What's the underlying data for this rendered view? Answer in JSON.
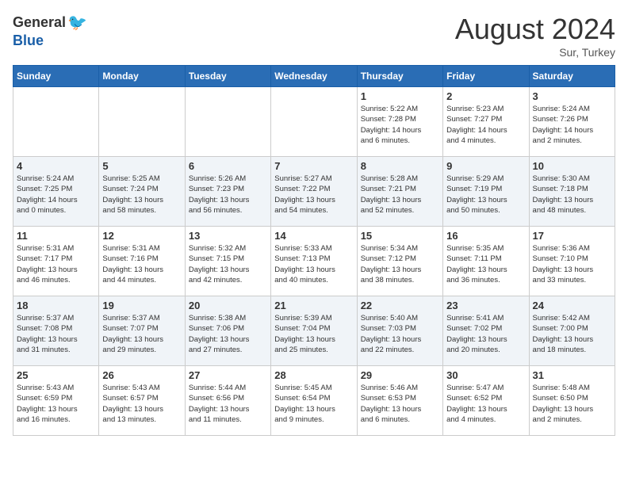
{
  "header": {
    "logo_general": "General",
    "logo_blue": "Blue",
    "month_title": "August 2024",
    "location": "Sur, Turkey"
  },
  "days_of_week": [
    "Sunday",
    "Monday",
    "Tuesday",
    "Wednesday",
    "Thursday",
    "Friday",
    "Saturday"
  ],
  "weeks": [
    [
      {
        "day": "",
        "info": ""
      },
      {
        "day": "",
        "info": ""
      },
      {
        "day": "",
        "info": ""
      },
      {
        "day": "",
        "info": ""
      },
      {
        "day": "1",
        "info": "Sunrise: 5:22 AM\nSunset: 7:28 PM\nDaylight: 14 hours\nand 6 minutes."
      },
      {
        "day": "2",
        "info": "Sunrise: 5:23 AM\nSunset: 7:27 PM\nDaylight: 14 hours\nand 4 minutes."
      },
      {
        "day": "3",
        "info": "Sunrise: 5:24 AM\nSunset: 7:26 PM\nDaylight: 14 hours\nand 2 minutes."
      }
    ],
    [
      {
        "day": "4",
        "info": "Sunrise: 5:24 AM\nSunset: 7:25 PM\nDaylight: 14 hours\nand 0 minutes."
      },
      {
        "day": "5",
        "info": "Sunrise: 5:25 AM\nSunset: 7:24 PM\nDaylight: 13 hours\nand 58 minutes."
      },
      {
        "day": "6",
        "info": "Sunrise: 5:26 AM\nSunset: 7:23 PM\nDaylight: 13 hours\nand 56 minutes."
      },
      {
        "day": "7",
        "info": "Sunrise: 5:27 AM\nSunset: 7:22 PM\nDaylight: 13 hours\nand 54 minutes."
      },
      {
        "day": "8",
        "info": "Sunrise: 5:28 AM\nSunset: 7:21 PM\nDaylight: 13 hours\nand 52 minutes."
      },
      {
        "day": "9",
        "info": "Sunrise: 5:29 AM\nSunset: 7:19 PM\nDaylight: 13 hours\nand 50 minutes."
      },
      {
        "day": "10",
        "info": "Sunrise: 5:30 AM\nSunset: 7:18 PM\nDaylight: 13 hours\nand 48 minutes."
      }
    ],
    [
      {
        "day": "11",
        "info": "Sunrise: 5:31 AM\nSunset: 7:17 PM\nDaylight: 13 hours\nand 46 minutes."
      },
      {
        "day": "12",
        "info": "Sunrise: 5:31 AM\nSunset: 7:16 PM\nDaylight: 13 hours\nand 44 minutes."
      },
      {
        "day": "13",
        "info": "Sunrise: 5:32 AM\nSunset: 7:15 PM\nDaylight: 13 hours\nand 42 minutes."
      },
      {
        "day": "14",
        "info": "Sunrise: 5:33 AM\nSunset: 7:13 PM\nDaylight: 13 hours\nand 40 minutes."
      },
      {
        "day": "15",
        "info": "Sunrise: 5:34 AM\nSunset: 7:12 PM\nDaylight: 13 hours\nand 38 minutes."
      },
      {
        "day": "16",
        "info": "Sunrise: 5:35 AM\nSunset: 7:11 PM\nDaylight: 13 hours\nand 36 minutes."
      },
      {
        "day": "17",
        "info": "Sunrise: 5:36 AM\nSunset: 7:10 PM\nDaylight: 13 hours\nand 33 minutes."
      }
    ],
    [
      {
        "day": "18",
        "info": "Sunrise: 5:37 AM\nSunset: 7:08 PM\nDaylight: 13 hours\nand 31 minutes."
      },
      {
        "day": "19",
        "info": "Sunrise: 5:37 AM\nSunset: 7:07 PM\nDaylight: 13 hours\nand 29 minutes."
      },
      {
        "day": "20",
        "info": "Sunrise: 5:38 AM\nSunset: 7:06 PM\nDaylight: 13 hours\nand 27 minutes."
      },
      {
        "day": "21",
        "info": "Sunrise: 5:39 AM\nSunset: 7:04 PM\nDaylight: 13 hours\nand 25 minutes."
      },
      {
        "day": "22",
        "info": "Sunrise: 5:40 AM\nSunset: 7:03 PM\nDaylight: 13 hours\nand 22 minutes."
      },
      {
        "day": "23",
        "info": "Sunrise: 5:41 AM\nSunset: 7:02 PM\nDaylight: 13 hours\nand 20 minutes."
      },
      {
        "day": "24",
        "info": "Sunrise: 5:42 AM\nSunset: 7:00 PM\nDaylight: 13 hours\nand 18 minutes."
      }
    ],
    [
      {
        "day": "25",
        "info": "Sunrise: 5:43 AM\nSunset: 6:59 PM\nDaylight: 13 hours\nand 16 minutes."
      },
      {
        "day": "26",
        "info": "Sunrise: 5:43 AM\nSunset: 6:57 PM\nDaylight: 13 hours\nand 13 minutes."
      },
      {
        "day": "27",
        "info": "Sunrise: 5:44 AM\nSunset: 6:56 PM\nDaylight: 13 hours\nand 11 minutes."
      },
      {
        "day": "28",
        "info": "Sunrise: 5:45 AM\nSunset: 6:54 PM\nDaylight: 13 hours\nand 9 minutes."
      },
      {
        "day": "29",
        "info": "Sunrise: 5:46 AM\nSunset: 6:53 PM\nDaylight: 13 hours\nand 6 minutes."
      },
      {
        "day": "30",
        "info": "Sunrise: 5:47 AM\nSunset: 6:52 PM\nDaylight: 13 hours\nand 4 minutes."
      },
      {
        "day": "31",
        "info": "Sunrise: 5:48 AM\nSunset: 6:50 PM\nDaylight: 13 hours\nand 2 minutes."
      }
    ]
  ]
}
